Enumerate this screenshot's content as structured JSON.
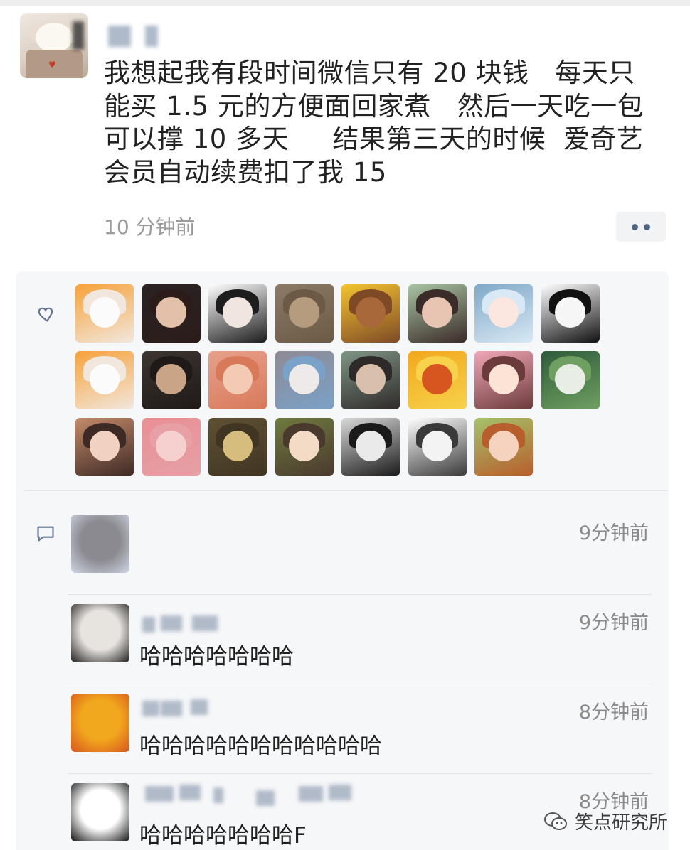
{
  "post": {
    "text": "我想起我有段时间微信只有 20 块钱   每天只\n能买 1.5 元的方便面回家煮   然后一天吃一包\n可以撑 10 多天     结果第三天的时候  爱奇艺\n会员自动续费扣了我 15",
    "time": "10 分钟前",
    "more_icon": "more-dots-icon"
  },
  "likes": {
    "icon": "heart-icon",
    "avatars": [
      {
        "c1": "#f6a23a",
        "c2": "#fbfbfb",
        "c3": "#f2e7dd"
      },
      {
        "c1": "#2a2323",
        "c2": "#e3c0a9",
        "c3": "#2b1c1a"
      },
      {
        "c1": "#ffffff",
        "c2": "#f0e6df",
        "c3": "#1d1d1d"
      },
      {
        "c1": "#8a7a66",
        "c2": "#b59c7e",
        "c3": "#6c5a46"
      },
      {
        "c1": "#f4c430",
        "c2": "#a8683a",
        "c3": "#7e4a26"
      },
      {
        "c1": "#a8c4a3",
        "c2": "#e7c5b2",
        "c3": "#3b2b29"
      },
      {
        "c1": "#7fa8c8",
        "c2": "#fbe6e0",
        "c3": "#d8e8f4"
      },
      {
        "c1": "#ffffff",
        "c2": "#f6f6f6",
        "c3": "#111111"
      },
      {
        "c1": "#f6a23a",
        "c2": "#fbfbfb",
        "c3": "#f2e7dd"
      },
      {
        "c1": "#3d3530",
        "c2": "#c9a487",
        "c3": "#1f1a18"
      },
      {
        "c1": "#e7a08c",
        "c2": "#f3cbb5",
        "c3": "#d87a5a"
      },
      {
        "c1": "#8f8a95",
        "c2": "#efeaea",
        "c3": "#7aa1c7"
      },
      {
        "c1": "#7f9584",
        "c2": "#d8c0ad",
        "c3": "#2f2a2a"
      },
      {
        "c1": "#f2a81e",
        "c2": "#d7561f",
        "c3": "#f7d24a"
      },
      {
        "c1": "#f1a7b8",
        "c2": "#fbe3d5",
        "c3": "#6b3b3b"
      },
      {
        "c1": "#2e5b3a",
        "c2": "#e8eee6",
        "c3": "#6fa061"
      },
      {
        "c1": "#c58a6a",
        "c2": "#f1d1bf",
        "c3": "#3d2a25"
      },
      {
        "c1": "#e88f95",
        "c2": "#f6cfcf",
        "c3": "#e6a0a6"
      },
      {
        "c1": "#5f5132",
        "c2": "#d6bd7d",
        "c3": "#403522"
      },
      {
        "c1": "#6f7a3f",
        "c2": "#f3dbc6",
        "c3": "#4a3a2e"
      },
      {
        "c1": "#d9d9d9",
        "c2": "#eaeaea",
        "c3": "#1a1a1a"
      },
      {
        "c1": "#ffffff",
        "c2": "#f3f3f3",
        "c3": "#3a3a3a"
      },
      {
        "c1": "#a5c36a",
        "c2": "#f5d3be",
        "c3": "#b85d2c"
      }
    ]
  },
  "comments": {
    "icon": "comment-bubble-icon",
    "items": [
      {
        "time": "9分钟前",
        "text": "",
        "a1": "#8b8a90",
        "a2": "#cfd6e4"
      },
      {
        "time": "9分钟前",
        "text": "哈哈哈哈哈哈哈",
        "a1": "#e7e3df",
        "a2": "#1e1e1e"
      },
      {
        "time": "8分钟前",
        "text": "哈哈哈哈哈哈哈哈哈哈哈",
        "a1": "#f2a81e",
        "a2": "#d7561f"
      },
      {
        "time": "8分钟前",
        "text": "哈哈哈哈哈哈哈F",
        "a1": "#ffffff",
        "a2": "#111111"
      }
    ]
  },
  "watermark": {
    "label": "笑点研究所",
    "icon": "wechat-logo-icon"
  }
}
